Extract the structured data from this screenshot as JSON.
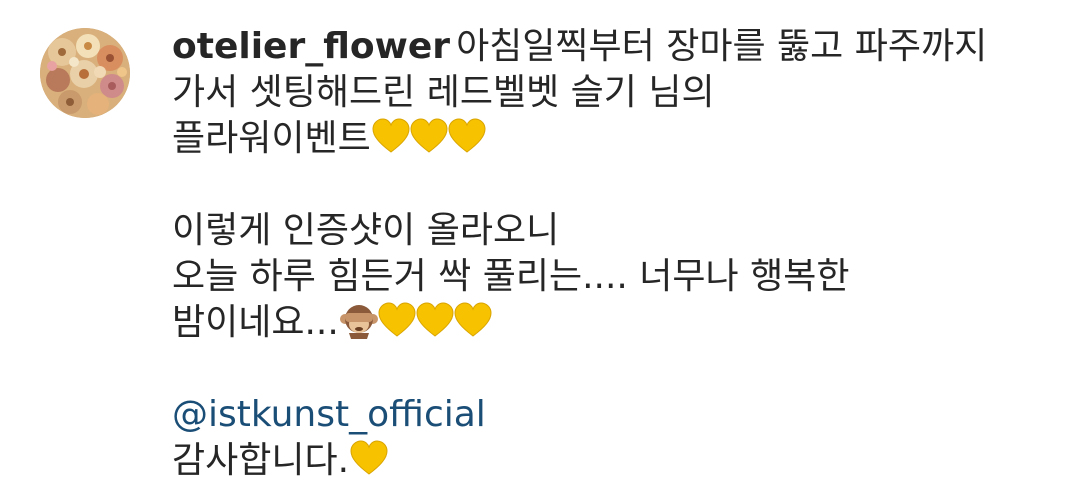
{
  "post": {
    "avatar_icon": "flower-avatar-icon",
    "username": "otelier_flower",
    "caption_lines": [
      "아침일찍부터 장마를 뚫고 파주까지",
      "가서 셋팅해드린 레드벨벳 슬기 님의",
      "플라워이벤트",
      "이렇게 인증샷이 올라오니",
      "오늘 하루 힘든거 싹 풀리는.... 너무나 행복한",
      "밤이네요...",
      "@istkunst_official",
      "감사합니다."
    ],
    "emojis": {
      "heart": "yellow-heart-icon",
      "monkey": "see-no-evil-monkey-icon"
    },
    "colors": {
      "text": "#262626",
      "mention": "#1b4e77",
      "heart": "#f7c200",
      "background": "#ffffff"
    }
  }
}
